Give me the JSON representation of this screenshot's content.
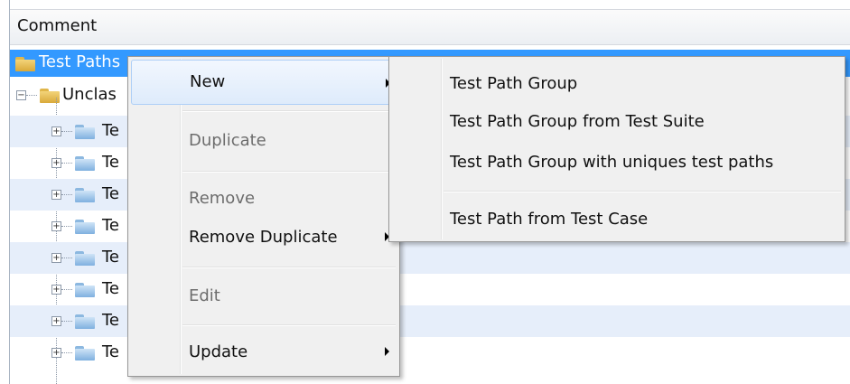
{
  "header": {
    "column_title": "Comment"
  },
  "tree": {
    "root_label": "Test Paths",
    "child_label": "Unclas",
    "items": [
      "Te",
      "Te",
      "Te",
      "Te",
      "Te",
      "Te",
      "Te",
      "Te"
    ]
  },
  "context_menu": {
    "new": "New",
    "duplicate": "Duplicate",
    "remove": "Remove",
    "remove_duplicate": "Remove Duplicate",
    "edit": "Edit",
    "update": "Update"
  },
  "submenu": {
    "group": "Test Path Group",
    "group_from_suite": "Test Path Group from Test Suite",
    "group_uniques": "Test Path Group with uniques test paths",
    "from_case": "Test Path from Test Case"
  },
  "colors": {
    "selection": "#3399ff",
    "alt_row": "#e6eefa",
    "menu_bg": "#f0f0f0"
  }
}
